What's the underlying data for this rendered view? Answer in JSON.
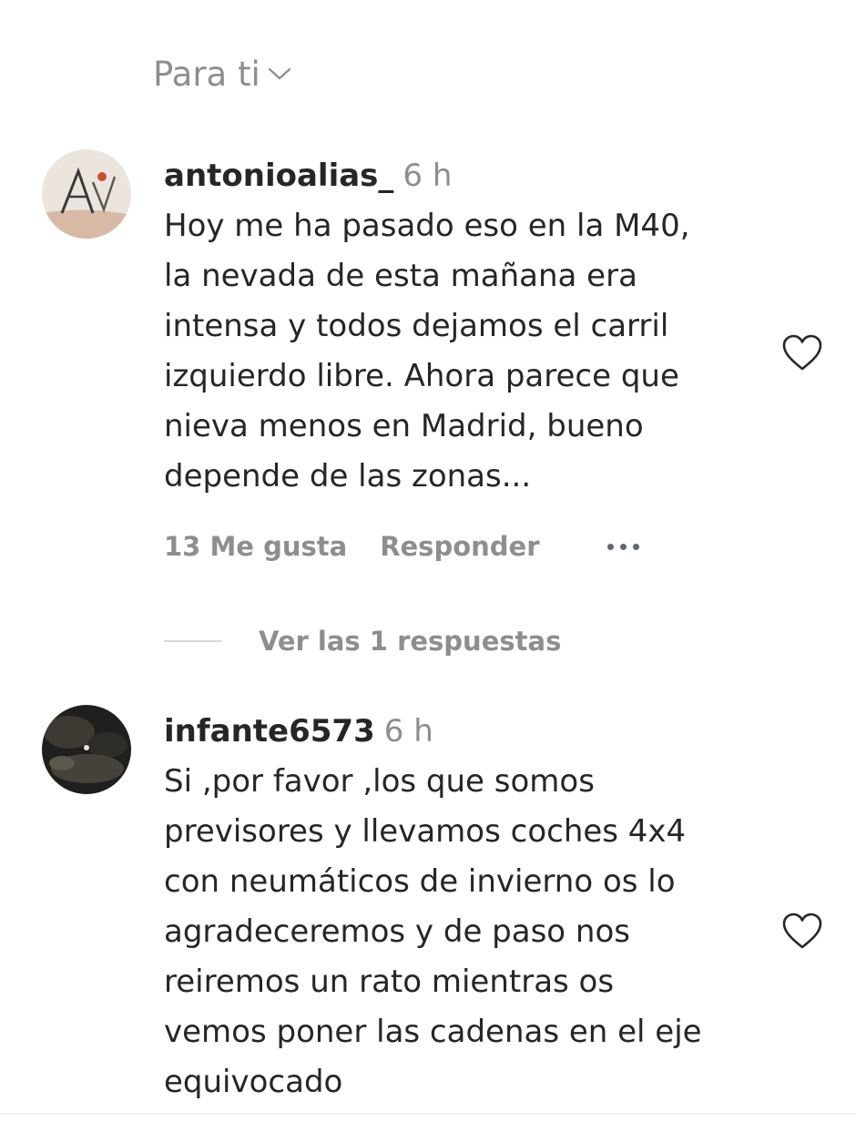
{
  "sort": {
    "label": "Para ti",
    "icon": "chevron-down-icon"
  },
  "comments": [
    {
      "username": "antonioalias_",
      "time": "6 h",
      "lines": [
        "Hoy me ha pasado eso en la M40,",
        "la nevada de esta mañana era",
        "intensa y todos dejamos el carril",
        "izquierdo libre. Ahora parece que",
        "nieva menos en Madrid, bueno",
        "depende de las zonas..."
      ],
      "likes_label": "13 Me gusta",
      "reply_label": "Responder",
      "more_icon": "more-options-icon",
      "like_icon": "heart-outline-icon",
      "view_replies_label": "Ver las 1 respuestas"
    },
    {
      "username": "infante6573",
      "time": "6 h",
      "lines": [
        "Si ,por favor ,los que somos",
        "previsores y llevamos coches 4x4",
        "con neumáticos de invierno os lo",
        "agradeceremos y de paso nos",
        "reiremos un rato mientras os",
        "vemos poner las cadenas en el eje",
        "equivocado"
      ],
      "like_icon": "heart-outline-icon"
    }
  ],
  "colors": {
    "text_primary": "#262626",
    "text_secondary": "#8e8e8e",
    "divider": "#dbdbdb"
  }
}
